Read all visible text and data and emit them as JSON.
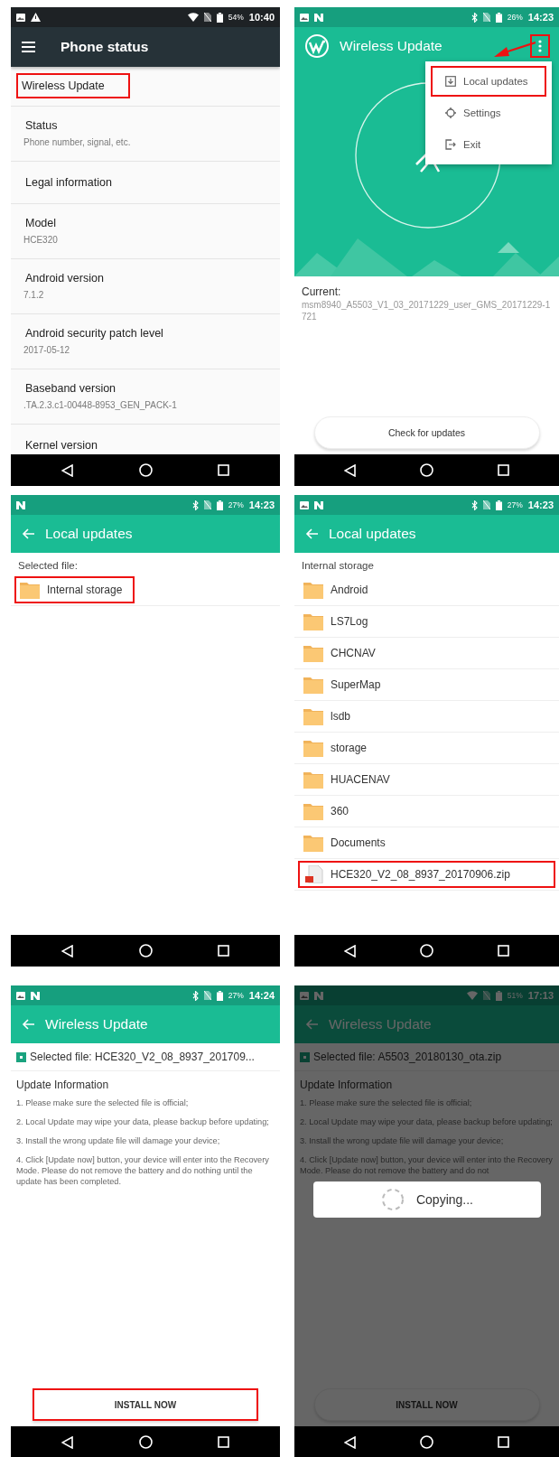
{
  "screens": [
    {
      "kind": "settings",
      "status_bar": {
        "battery": "54%",
        "time": "10:40"
      },
      "app_bar": {
        "title": "Phone status"
      },
      "items": [
        {
          "title": "Wireless Update",
          "highlighted": true
        },
        {
          "title": "Status",
          "summary": "Phone number, signal, etc.",
          "highlighted": false
        },
        {
          "title": "Legal information",
          "highlighted": false
        },
        {
          "title": "Model",
          "summary": "HCE320",
          "highlighted": false
        },
        {
          "title": "Android version",
          "summary": "7.1.2",
          "highlighted": false
        },
        {
          "title": "Android security patch level",
          "summary": "2017-05-12",
          "highlighted": false
        },
        {
          "title": "Baseband version",
          "summary": ".TA.2.3.c1-00448-8953_GEN_PACK-1",
          "highlighted": false
        },
        {
          "title": "Kernel version",
          "highlighted": false
        }
      ]
    },
    {
      "kind": "home",
      "status_bar": {
        "battery": "26%",
        "time": "14:23"
      },
      "app_bar": {
        "title": "Wireless Update",
        "overflow_highlighted": true,
        "pointer_arrow": true
      },
      "menu": [
        {
          "label": "Local updates",
          "highlighted": true
        },
        {
          "label": "Settings",
          "highlighted": false
        },
        {
          "label": "Exit",
          "highlighted": false
        }
      ],
      "current_label": "Current:",
      "current_value": "msm8940_A5503_V1_03_20171229_user_GMS_20171229-1721",
      "button": {
        "label": "Check for updates",
        "highlighted": false
      }
    },
    {
      "kind": "files",
      "status_bar": {
        "battery": "27%",
        "time": "14:23"
      },
      "app_bar": {
        "title": "Local updates"
      },
      "label": "Selected file:",
      "entries": [
        {
          "kind": "folder",
          "name": "Internal storage",
          "highlighted": true
        }
      ]
    },
    {
      "kind": "files",
      "status_bar": {
        "battery": "27%",
        "time": "14:23"
      },
      "app_bar": {
        "title": "Local updates"
      },
      "label": "Internal storage",
      "entries": [
        {
          "kind": "folder",
          "name": "Android",
          "highlighted": false
        },
        {
          "kind": "folder",
          "name": "LS7Log",
          "highlighted": false
        },
        {
          "kind": "folder",
          "name": "CHCNAV",
          "highlighted": false
        },
        {
          "kind": "folder",
          "name": "SuperMap",
          "highlighted": false
        },
        {
          "kind": "folder",
          "name": "lsdb",
          "highlighted": false
        },
        {
          "kind": "folder",
          "name": "storage",
          "highlighted": false
        },
        {
          "kind": "folder",
          "name": "HUACENAV",
          "highlighted": false
        },
        {
          "kind": "folder",
          "name": "360",
          "highlighted": false
        },
        {
          "kind": "folder",
          "name": "Documents",
          "highlighted": false
        },
        {
          "kind": "zip",
          "name": "HCE320_V2_08_8937_20170906.zip",
          "highlighted": true
        }
      ]
    },
    {
      "kind": "install",
      "status_bar": {
        "battery": "27%",
        "time": "14:24"
      },
      "app_bar": {
        "title": "Wireless Update"
      },
      "selected_file": "Selected file: HCE320_V2_08_8937_201709...",
      "heading": "Update Information",
      "notes": [
        "1. Please make sure the selected file is official;",
        "2. Local Update may wipe your data, please backup before updating;",
        "3. Install the wrong update file will damage your device;",
        "4. Click [Update now] button, your device will enter into the Recovery Mode. Please do not remove the battery and do nothing until the update has been completed."
      ],
      "button": {
        "label": "INSTALL NOW",
        "highlighted": true
      }
    },
    {
      "kind": "install",
      "dimmed": true,
      "status_bar": {
        "battery": "51%",
        "time": "17:13"
      },
      "app_bar": {
        "title": "Wireless Update"
      },
      "selected_file": "Selected file: A5503_20180130_ota.zip",
      "heading": "Update Information",
      "notes": [
        "1. Please make sure the selected file is official;",
        "2. Local Update may wipe your data, please backup before updating;",
        "3. Install the wrong update file will damage your device;",
        "4. Click [Update now] button, your device will enter into the Recovery Mode. Please do not remove the battery and do not"
      ],
      "dialog": {
        "message": "Copying..."
      },
      "button": {
        "label": "INSTALL NOW",
        "highlighted": false
      }
    }
  ]
}
